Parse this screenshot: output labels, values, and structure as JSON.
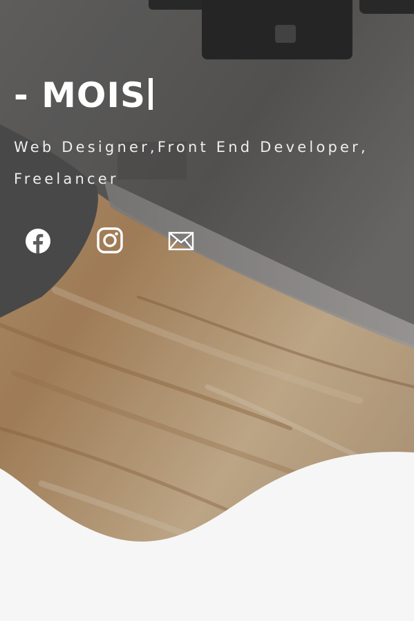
{
  "header": {
    "title": "- MOIS",
    "subtitle": "Web Designer,Front End Developer, Freelancer"
  },
  "social": [
    {
      "icon": "facebook-icon",
      "label": "Facebook"
    },
    {
      "icon": "instagram-icon",
      "label": "Instagram"
    },
    {
      "icon": "mail-icon",
      "label": "Email"
    }
  ],
  "colors": {
    "text": "#ffffff",
    "wave": "#f6f6f6",
    "desk_wood": "#b9936b",
    "laptop": "#5c5b5a"
  }
}
